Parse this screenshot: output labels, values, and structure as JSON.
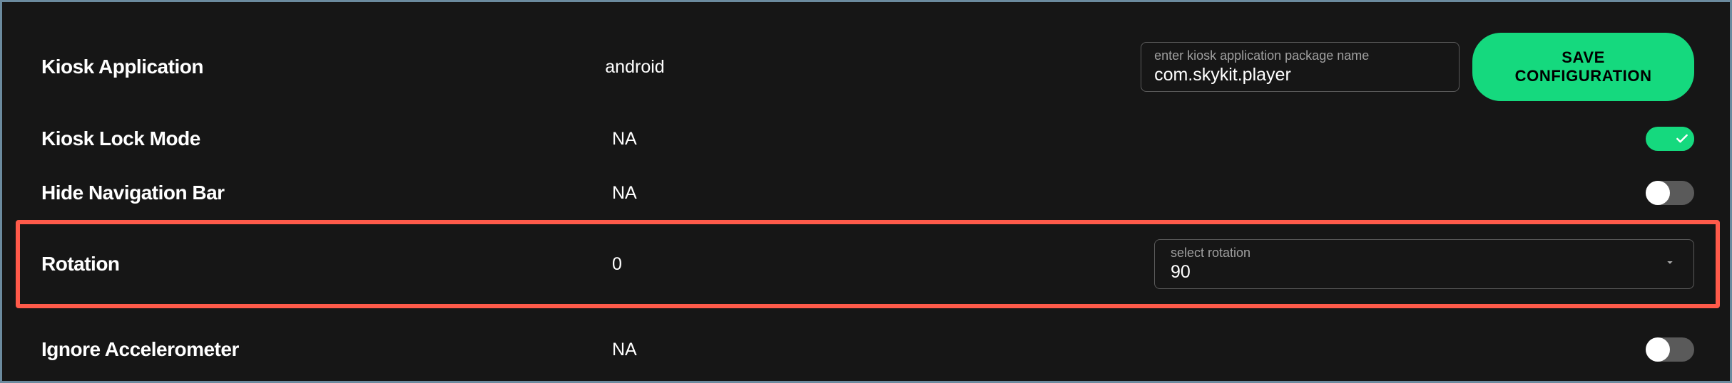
{
  "rows": {
    "kiosk_app": {
      "label": "Kiosk Application",
      "value": "android",
      "input_label": "enter kiosk application package name",
      "input_value": "com.skykit.player",
      "save_label": "SAVE CONFIGURATION"
    },
    "kiosk_lock": {
      "label": "Kiosk Lock Mode",
      "value": "NA"
    },
    "hide_nav": {
      "label": "Hide Navigation Bar",
      "value": "NA"
    },
    "rotation": {
      "label": "Rotation",
      "value": "0",
      "select_label": "select rotation",
      "select_value": "90"
    },
    "ignore_accel": {
      "label": "Ignore Accelerometer",
      "value": "NA"
    }
  }
}
